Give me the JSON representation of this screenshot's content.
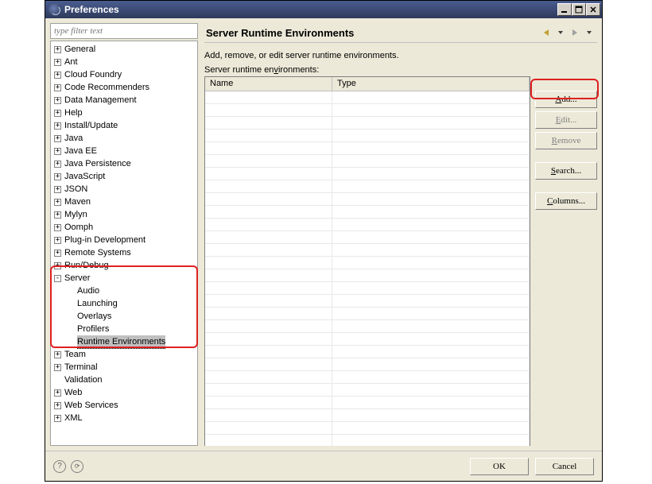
{
  "window": {
    "title": "Preferences"
  },
  "filter": {
    "placeholder": "type filter text"
  },
  "tree": {
    "items": [
      {
        "label": "General",
        "exp": "+"
      },
      {
        "label": "Ant",
        "exp": "+"
      },
      {
        "label": "Cloud Foundry",
        "exp": "+"
      },
      {
        "label": "Code Recommenders",
        "exp": "+"
      },
      {
        "label": "Data Management",
        "exp": "+"
      },
      {
        "label": "Help",
        "exp": "+"
      },
      {
        "label": "Install/Update",
        "exp": "+"
      },
      {
        "label": "Java",
        "exp": "+"
      },
      {
        "label": "Java EE",
        "exp": "+"
      },
      {
        "label": "Java Persistence",
        "exp": "+"
      },
      {
        "label": "JavaScript",
        "exp": "+"
      },
      {
        "label": "JSON",
        "exp": "+"
      },
      {
        "label": "Maven",
        "exp": "+"
      },
      {
        "label": "Mylyn",
        "exp": "+"
      },
      {
        "label": "Oomph",
        "exp": "+"
      },
      {
        "label": "Plug-in Development",
        "exp": "+"
      },
      {
        "label": "Remote Systems",
        "exp": "+"
      },
      {
        "label": "Run/Debug",
        "exp": "+"
      },
      {
        "label": "Server",
        "exp": "-",
        "children": [
          {
            "label": "Audio"
          },
          {
            "label": "Launching"
          },
          {
            "label": "Overlays"
          },
          {
            "label": "Profilers"
          },
          {
            "label": "Runtime Environments",
            "selected": true
          }
        ]
      },
      {
        "label": "Team",
        "exp": "+"
      },
      {
        "label": "Terminal",
        "exp": "+"
      },
      {
        "label": "Validation"
      },
      {
        "label": "Web",
        "exp": "+"
      },
      {
        "label": "Web Services",
        "exp": "+"
      },
      {
        "label": "XML",
        "exp": "+"
      }
    ]
  },
  "page": {
    "title": "Server Runtime Environments",
    "description": "Add, remove, or edit server runtime environments.",
    "table_label_pre": "Server runtime en",
    "table_label_u": "v",
    "table_label_post": "ironments:",
    "columns": [
      "Name",
      "Type"
    ]
  },
  "buttons": {
    "add_u": "A",
    "add_post": "dd...",
    "edit_u": "E",
    "edit_post": "dit...",
    "remove_u": "R",
    "remove_post": "emove",
    "search_u": "S",
    "search_post": "earch...",
    "columns_u": "C",
    "columns_post": "olumns..."
  },
  "footer": {
    "ok": "OK",
    "cancel": "Cancel"
  },
  "empty_rows": 28
}
